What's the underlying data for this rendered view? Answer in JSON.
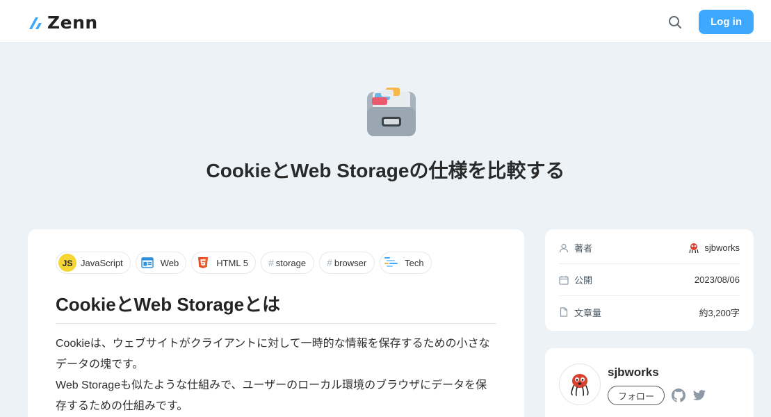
{
  "header": {
    "logo_text": "Zenn",
    "search_icon": "search-icon",
    "login_label": "Log in",
    "accent_color": "#3ea8ff"
  },
  "article": {
    "emoji": "card-file-box-emoji",
    "title": "CookieとWeb Storageの仕様を比較する",
    "topics": [
      {
        "label": "JavaScript",
        "icon": "javascript-icon"
      },
      {
        "label": "Web",
        "icon": "web-icon"
      },
      {
        "label": "HTML 5",
        "icon": "html5-icon"
      },
      {
        "label": "storage",
        "icon": "#"
      },
      {
        "label": "browser",
        "icon": "#"
      },
      {
        "label": "Tech",
        "icon": "tech-icon"
      }
    ],
    "heading": "CookieとWeb Storageとは",
    "paragraph_lines": [
      "Cookieは、ウェブサイトがクライアントに対して一時的な情報を保存するための小さな",
      "データの塊です。",
      "Web Storageも似たような仕組みで、ユーザーのローカル環境のブラウザにデータを保",
      "存するための仕組みです。"
    ]
  },
  "meta": {
    "author_label": "著者",
    "author_value": "sjbworks",
    "published_label": "公開",
    "published_value": "2023/08/06",
    "length_label": "文章量",
    "length_value": "約3,200字"
  },
  "author_card": {
    "name": "sjbworks",
    "follow_label": "フォロー",
    "social_icons": [
      "github-icon",
      "twitter-icon"
    ]
  }
}
